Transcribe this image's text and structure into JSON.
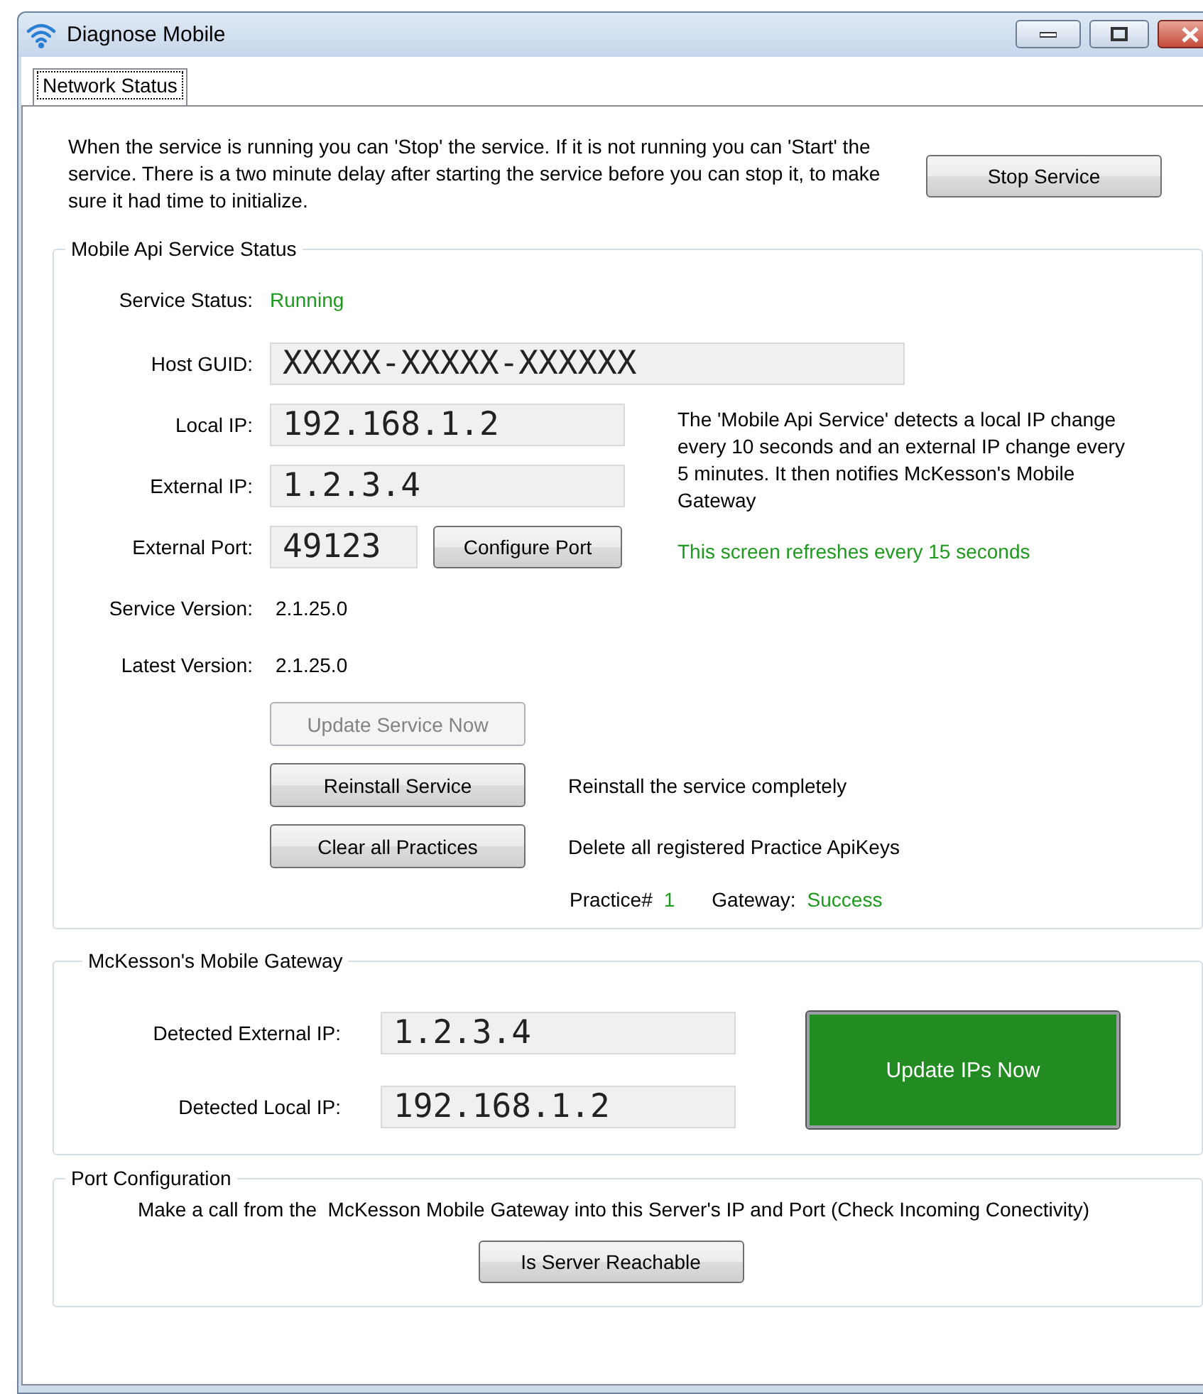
{
  "window": {
    "title": "Diagnose Mobile"
  },
  "tabs": [
    {
      "label": "Network Status",
      "selected": true
    }
  ],
  "intro": {
    "text": "When the service is running you can 'Stop' the service. If it is not running you can 'Start' the service. There is a two minute delay after starting the service before you can stop it, to make sure it had time to initialize.",
    "button": "Stop Service"
  },
  "service_group": {
    "title": "Mobile Api Service Status",
    "status": {
      "label": "Service Status:",
      "value": "Running"
    },
    "host_guid": {
      "label": "Host GUID:",
      "value": "XXXXX-XXXXX-XXXXXX"
    },
    "local_ip": {
      "label": "Local IP:",
      "value": "192.168.1.2"
    },
    "external_ip": {
      "label": "External IP:",
      "value": "1.2.3.4"
    },
    "external_port": {
      "label": "External Port:",
      "value": "49123",
      "button": "Configure Port"
    },
    "info_text": "The 'Mobile Api Service' detects a local IP change every 10 seconds and an external IP change every 5 minutes. It then notifies McKesson's Mobile Gateway",
    "refresh_note": "This screen refreshes every 15 seconds",
    "service_version": {
      "label": "Service Version:",
      "value": "2.1.25.0"
    },
    "latest_version": {
      "label": "Latest Version:",
      "value": "2.1.25.0"
    },
    "actions": [
      {
        "label": "Update Service Now",
        "disabled": true
      },
      {
        "label": "Reinstall Service",
        "disabled": false,
        "description": "Reinstall the service completely"
      },
      {
        "label": "Clear all Practices",
        "disabled": false,
        "description": "Delete all registered Practice ApiKeys"
      }
    ],
    "practice": {
      "label": "Practice#",
      "value": "1"
    },
    "gateway": {
      "label": "Gateway:",
      "value": "Success"
    }
  },
  "gateway_group": {
    "title": "McKesson's Mobile Gateway",
    "detected_external_ip": {
      "label": "Detected External IP:",
      "value": "1.2.3.4"
    },
    "detected_local_ip": {
      "label": "Detected Local IP:",
      "value": "192.168.1.2"
    },
    "button": "Update IPs Now"
  },
  "port_group": {
    "title": "Port Configuration",
    "text": "Make a call from the  McKesson Mobile Gateway into this Server's IP and Port (Check Incoming Conectivity)",
    "button": "Is Server Reachable"
  }
}
